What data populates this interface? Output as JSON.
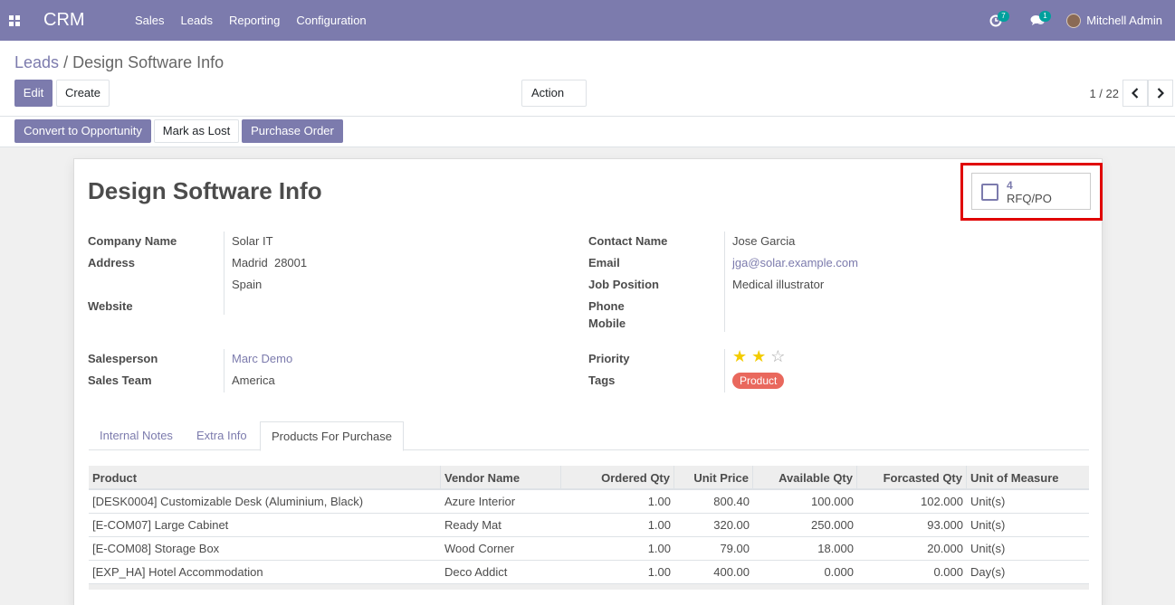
{
  "navbar": {
    "brand": "CRM",
    "menu": [
      "Sales",
      "Leads",
      "Reporting",
      "Configuration"
    ],
    "activity_count": "7",
    "message_count": "1",
    "user_name": "Mitchell Admin"
  },
  "breadcrumb": {
    "parent": "Leads",
    "separator": "/",
    "current": "Design Software Info"
  },
  "toolbar": {
    "edit": "Edit",
    "create": "Create",
    "action": "Action"
  },
  "pager": {
    "value": "1 / 22"
  },
  "statusbar": {
    "convert": "Convert to Opportunity",
    "lost": "Mark as Lost",
    "purchase": "Purchase Order"
  },
  "record": {
    "title": "Design Software Info",
    "smart_button": {
      "value": "4",
      "label": "RFQ/PO"
    },
    "left_fields": {
      "company_label": "Company Name",
      "company": "Solar IT",
      "address_label": "Address",
      "address_line1": "Madrid  28001",
      "address_line2": "Spain",
      "website_label": "Website",
      "salesperson_label": "Salesperson",
      "salesperson": "Marc Demo",
      "team_label": "Sales Team",
      "team": "America"
    },
    "right_fields": {
      "contact_label": "Contact Name",
      "contact": "Jose Garcia",
      "email_label": "Email",
      "email": "jga@solar.example.com",
      "job_label": "Job Position",
      "job": "Medical illustrator",
      "phone_label": "Phone",
      "mobile_label": "Mobile",
      "priority_label": "Priority",
      "priority": 2,
      "priority_max": 3,
      "tags_label": "Tags",
      "tag": "Product"
    }
  },
  "tabs": [
    "Internal Notes",
    "Extra Info",
    "Products For Purchase"
  ],
  "active_tab": "Products For Purchase",
  "products_table": {
    "headers": [
      "Product",
      "Vendor Name",
      "Ordered Qty",
      "Unit Price",
      "Available Qty",
      "Forcasted Qty",
      "Unit of Measure"
    ],
    "rows": [
      [
        "[DESK0004] Customizable Desk (Aluminium, Black)",
        "Azure Interior",
        "1.00",
        "800.40",
        "100.000",
        "102.000",
        "Unit(s)"
      ],
      [
        "[E-COM07] Large Cabinet",
        "Ready Mat",
        "1.00",
        "320.00",
        "250.000",
        "93.000",
        "Unit(s)"
      ],
      [
        "[E-COM08] Storage Box",
        "Wood Corner",
        "1.00",
        "79.00",
        "18.000",
        "20.000",
        "Unit(s)"
      ],
      [
        "[EXP_HA] Hotel Accommodation",
        "Deco Addict",
        "1.00",
        "400.00",
        "0.000",
        "0.000",
        "Day(s)"
      ]
    ]
  },
  "colors": {
    "brand": "#7c7bad",
    "badge": "#00a09d",
    "tag": "#e9685d",
    "highlight": "#e00000",
    "star": "#f3cc00"
  }
}
